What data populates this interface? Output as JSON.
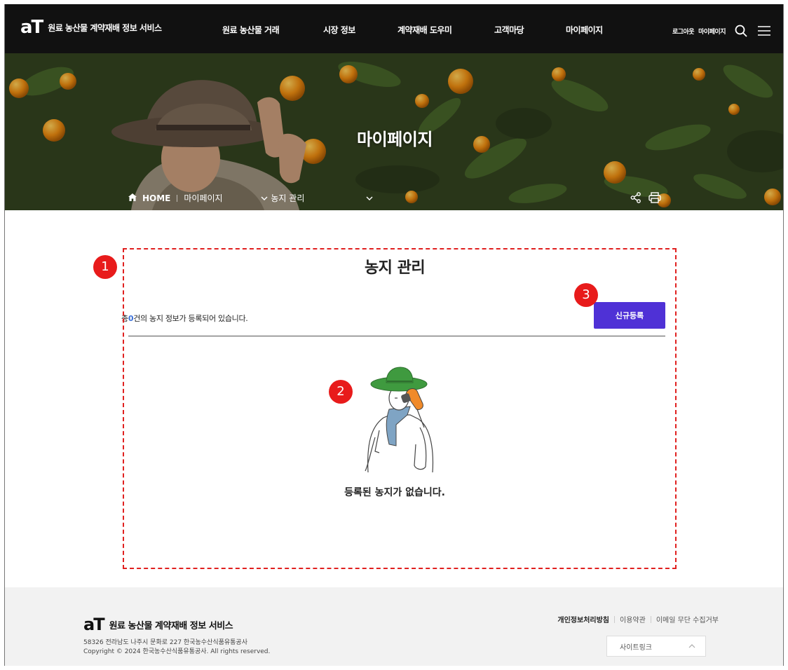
{
  "header": {
    "logo_mark": "aT",
    "logo_text": "원료 농산물 계약재배 정보 서비스",
    "nav": [
      "원료 농산물 거래",
      "시장 정보",
      "계약재배 도우미",
      "고객마당",
      "마이페이지"
    ],
    "util": {
      "logout": "로그아웃",
      "mypage": "마이페이지"
    }
  },
  "hero": {
    "title": "마이페이지",
    "breadcrumb": {
      "home": "HOME",
      "level1": "마이페이지",
      "level2": "농지 관리"
    }
  },
  "main": {
    "title": "농지 관리",
    "count_prefix": "총",
    "count": "0",
    "count_suffix": "건의 농지 정보가 등록되어 있습니다.",
    "new_button": "신규등록",
    "empty_message": "등록된 농지가 없습니다."
  },
  "annotations": [
    "1",
    "2",
    "3"
  ],
  "footer": {
    "logo_mark": "aT",
    "logo_text": "원료 농산물 계약재배 정보 서비스",
    "address": "58326 전라남도 나주시 문화로 227 한국농수산식품유통공사",
    "copyright": "Copyright © 2024 한국농수산식품유통공사. All rights reserved.",
    "links": [
      "개인정보처리방침",
      "이용약관",
      "이메일 무단 수집거부"
    ],
    "sitelink": "사이트링크"
  },
  "colors": {
    "accent": "#4f31d6",
    "count_num": "#3a6fd8",
    "annotation": "#e81b1b"
  },
  "icons": [
    "search-icon",
    "menu-icon",
    "home-icon",
    "share-icon",
    "print-icon",
    "chevron-down-icon",
    "chevron-up-icon"
  ]
}
